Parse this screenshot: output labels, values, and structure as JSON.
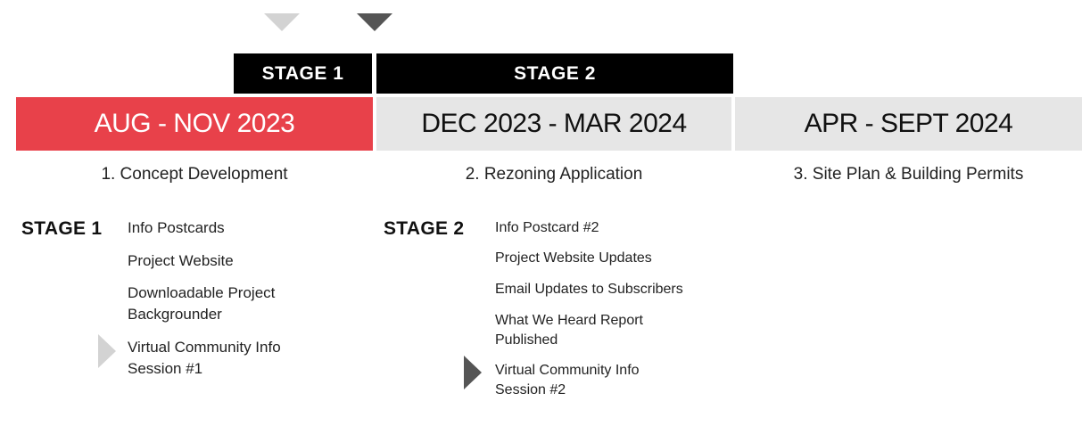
{
  "colors": {
    "accent": "#e8414a",
    "band_grey": "#e6e6e6",
    "tab_black": "#000000",
    "marker_light": "#d3d3d3",
    "marker_dark": "#555555"
  },
  "markers": {
    "top_light": "triangle-down-light-icon",
    "top_dark": "triangle-down-dark-icon",
    "stage1_current": "triangle-right-light-icon",
    "stage2_current": "triangle-right-dark-icon"
  },
  "tabs": {
    "stage1": "STAGE 1",
    "stage2": "STAGE 2"
  },
  "bands": [
    {
      "date": "AUG - NOV 2023",
      "title": "1. Concept Development"
    },
    {
      "date": "DEC 2023 - MAR 2024",
      "title": "2. Rezoning Application"
    },
    {
      "date": "APR - SEPT 2024",
      "title": "3. Site Plan & Building Permits"
    }
  ],
  "stage1": {
    "label": "STAGE 1",
    "items": [
      "Info Postcards",
      "Project Website",
      "Downloadable Project Backgrounder",
      "Virtual Community Info Session #1"
    ]
  },
  "stage2": {
    "label": "STAGE 2",
    "items": [
      "Info Postcard #2",
      "Project Website Updates",
      "Email Updates to Subscribers",
      "What We Heard Report Published",
      "Virtual Community Info Session #2"
    ]
  }
}
